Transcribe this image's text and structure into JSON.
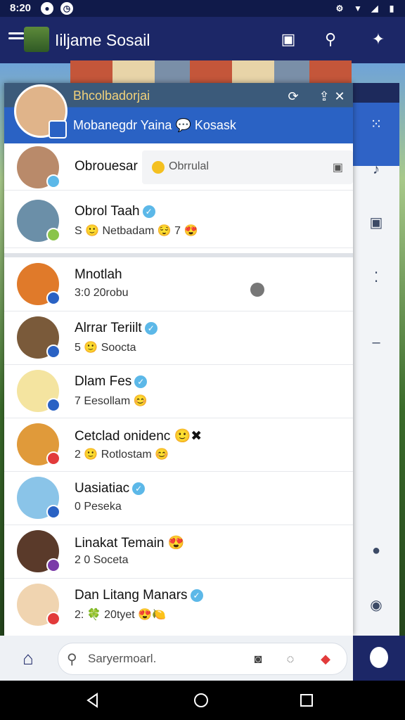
{
  "status": {
    "time": "8:20"
  },
  "appbar": {
    "title": "Iiljame Sosail"
  },
  "overlay_header": {
    "name": "Bhcolbadorjai",
    "subtitle": "Mobanegdr Yaina 💬 Kosask"
  },
  "first_row": {
    "name": "Obrouesar",
    "chip": "Obrrulal"
  },
  "contacts": [
    {
      "name": "Obrol Taah",
      "msg": "S 🙂 Netbadam 😌 7 😍",
      "verified": true,
      "avatar": "#6b8fa8"
    },
    {
      "name": "Mnotlah",
      "msg": "3:0 20robu",
      "verified": false,
      "avatar": "#e07a2a"
    },
    {
      "name": "Alrrar Teriilt",
      "msg": "5 🙂 Soocta",
      "verified": true,
      "avatar": "#7a5a3a"
    },
    {
      "name": "Dlam Fes",
      "msg": "7 Eesollam 😊",
      "verified": true,
      "avatar": "#f4e4a0"
    },
    {
      "name": "Cetclad onidenc 🙂✖",
      "msg": "2 🙂 Rotlostam 😊",
      "verified": false,
      "avatar": "#e09a3a"
    },
    {
      "name": "Uasiatiac",
      "msg": "0 Peseka",
      "verified": true,
      "avatar": "#8ac4e8"
    },
    {
      "name": "Linakat Temain 😍",
      "msg": "2 0 Soceta",
      "verified": false,
      "avatar": "#5a3a2a"
    },
    {
      "name": "Dan Litang Manars",
      "msg": "2: 🍀 20tyet 😍🍋",
      "verified": true,
      "avatar": "#f0d4b0"
    }
  ],
  "search": {
    "placeholder": "Saryermoarl."
  }
}
